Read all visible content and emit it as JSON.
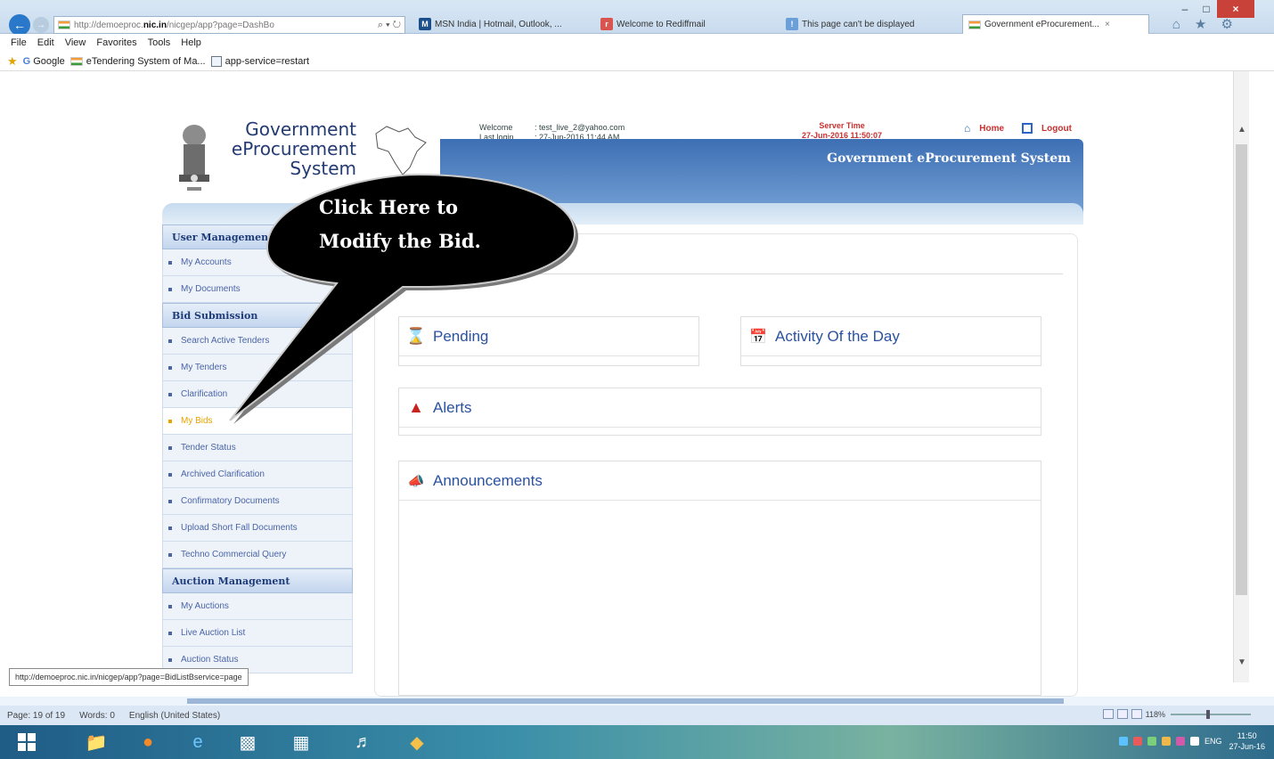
{
  "browser": {
    "address_prefix": "http://demoeproc.",
    "address_host": "nic.in",
    "address_suffix": "/nicgep/app?page=DashBo",
    "address_btns": "⌕ ▾ ↻",
    "tabs": [
      {
        "label": "MSN India | Hotmail, Outlook, ...",
        "icon": "msn-icon",
        "color": "#1b4f8a"
      },
      {
        "label": "Welcome to Rediffmail",
        "icon": "rediff-icon",
        "color": "#d9534f"
      },
      {
        "label": "This page can't be displayed",
        "icon": "error-page-icon",
        "color": "#6a9fd8"
      },
      {
        "label": "Government eProcurement...",
        "icon": "india-flag-icon",
        "color": "#f39b3a",
        "close": "×"
      }
    ],
    "window_controls": [
      "–",
      "□",
      "×"
    ],
    "toolbar_icons": "⌂ ★ ⚙",
    "menu": [
      "File",
      "Edit",
      "View",
      "Favorites",
      "Tools",
      "Help"
    ],
    "favorites": [
      {
        "label": "Google",
        "icon": "google-icon"
      },
      {
        "label": "eTendering System of Ma...",
        "icon": "india-flag-icon"
      },
      {
        "label": "app-service=restart",
        "icon": "page-icon"
      }
    ]
  },
  "header": {
    "logo_line1": "Government",
    "logo_line2": "eProcurement",
    "logo_line3": "System",
    "welcome_label": "Welcome",
    "welcome_value": ": test_live_2@yahoo.com",
    "last_login_label": "Last login",
    "last_login_value": ": 27-Jun-2016 11:44 AM",
    "server_time_label": "Server Time",
    "server_time_value": "27-Jun-2016 11:50:07",
    "home_label": "Home",
    "logout_label": "Logout",
    "band_title": "Government eProcurement System"
  },
  "sidebar": {
    "sections": [
      {
        "title": "User Management",
        "items": [
          "My Accounts",
          "My Documents"
        ]
      },
      {
        "title": "Bid Submission",
        "items": [
          "Search Active Tenders",
          "My Tenders",
          "Clarification",
          "My Bids",
          "Tender Status",
          "Archived Clarification",
          "Confirmatory Documents",
          "Upload Short Fall Documents",
          "Techno Commercial Query"
        ]
      },
      {
        "title": "Auction Management",
        "items": [
          "My Auctions",
          "Live Auction List",
          "Auction Status"
        ]
      }
    ],
    "active_item": "My Bids"
  },
  "panels": {
    "pending": "Pending",
    "activity": "Activity Of the Day",
    "alerts": "Alerts",
    "announcements": "Announcements"
  },
  "callout": {
    "line1": "Click Here to",
    "line2": "Modify the Bid."
  },
  "status_url": "http://demoeproc.nic.in/nicgep/app?page=BidListBservice=page",
  "wordbar": {
    "page": "Page: 19 of 19",
    "words": "Words: 0",
    "language": "English (United States)",
    "zoom": "118%"
  },
  "taskbar": {
    "clock_time": "11:50",
    "clock_date": "27-Jun-16",
    "lang": "ENG"
  },
  "colors": {
    "accent": "#2a52a0",
    "band": "#3d6fb4",
    "active_menu": "#e8a300",
    "alert_red": "#c93030"
  }
}
